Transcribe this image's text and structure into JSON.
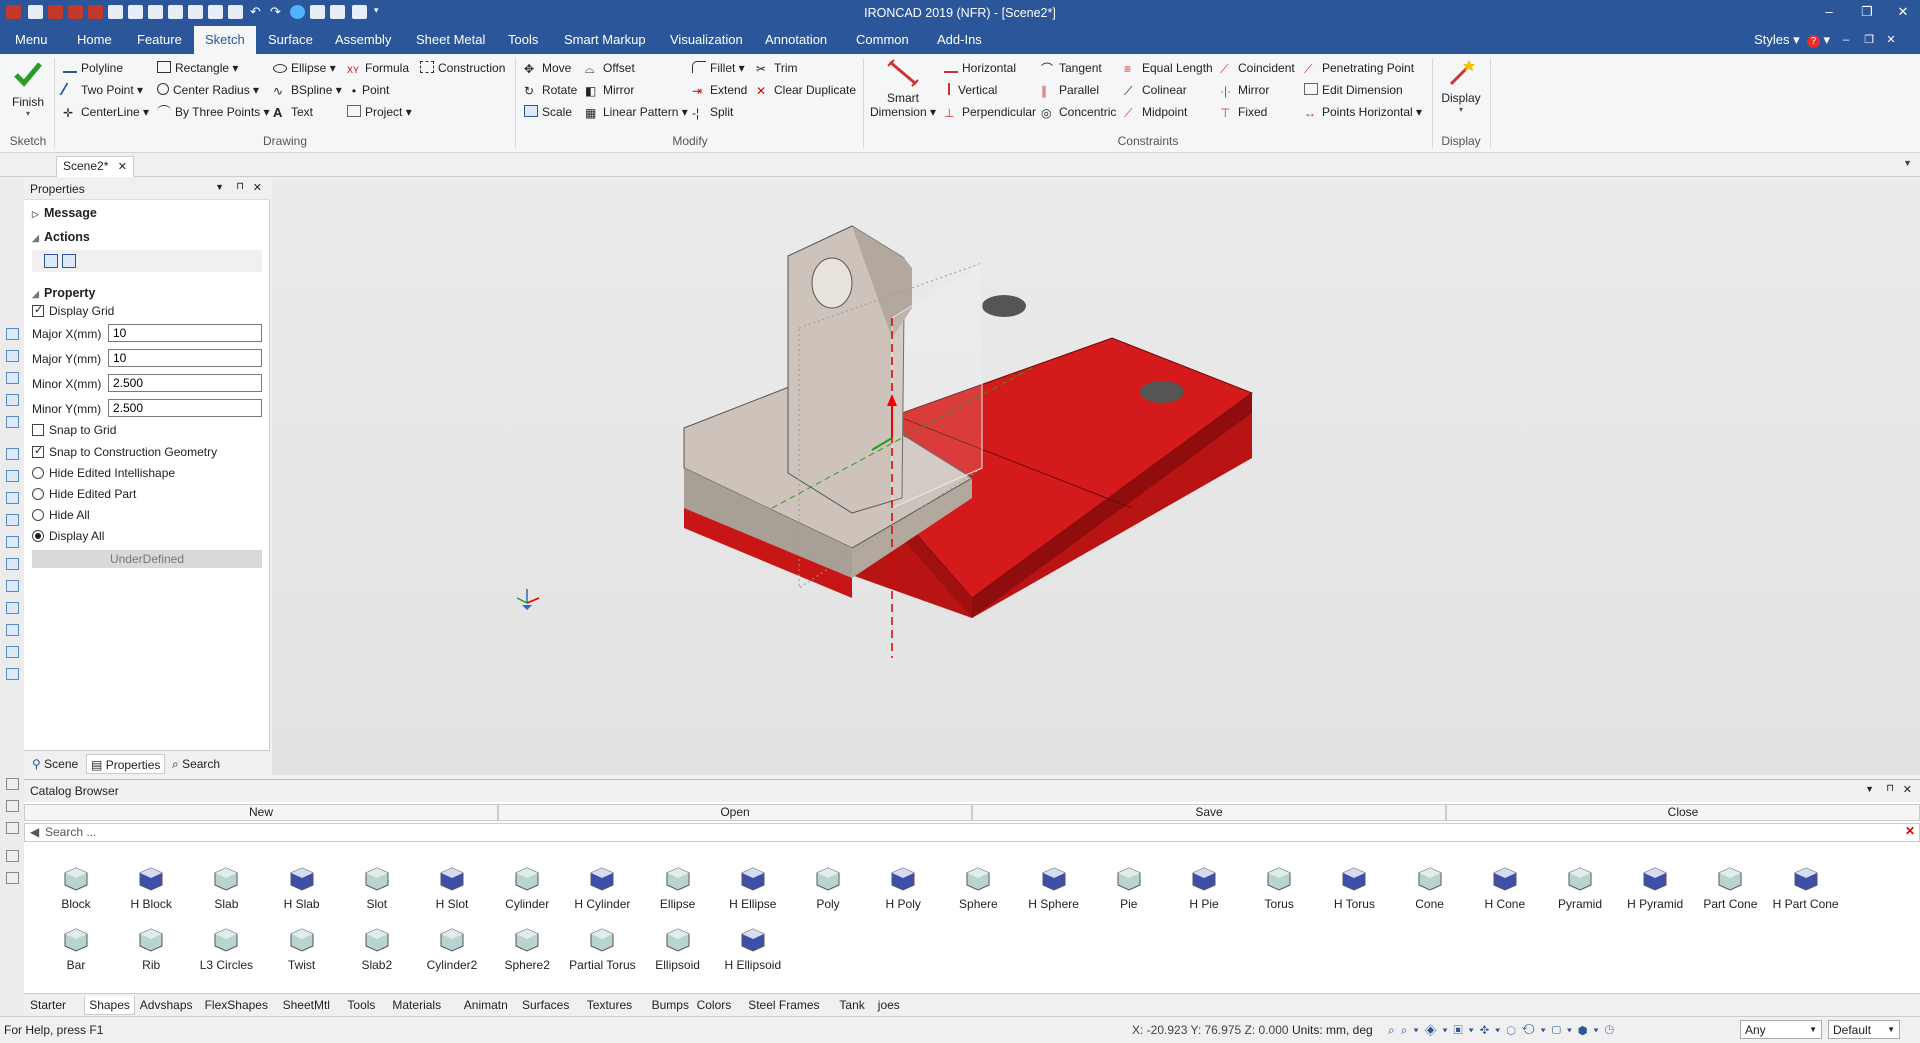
{
  "app": {
    "title": "IRONCAD 2019 (NFR) - [Scene2*]"
  },
  "menu": {
    "tabs": [
      "Menu",
      "Home",
      "Feature",
      "Sketch",
      "Surface",
      "Assembly",
      "Sheet Metal",
      "Tools",
      "Smart Markup",
      "Visualization",
      "Annotation",
      "Common",
      "Add-Ins"
    ],
    "active": "Sketch",
    "styles": "Styles"
  },
  "ribbon": {
    "sketch": {
      "finish": "Finish",
      "group": "Sketch"
    },
    "drawing": {
      "group": "Drawing",
      "items": [
        "Polyline",
        "Two Point",
        "CenterLine",
        "Rectangle",
        "Center Radius",
        "By Three Points",
        "Ellipse",
        "BSpline",
        "Text",
        "Formula",
        "Point",
        "Project",
        "Construction"
      ]
    },
    "modify": {
      "group": "Modify",
      "items": [
        "Move",
        "Rotate",
        "Scale",
        "Offset",
        "Mirror",
        "Linear Pattern",
        "Fillet",
        "Extend",
        "Split",
        "Trim",
        "Clear Duplicate"
      ]
    },
    "constraints": {
      "group": "Constraints",
      "smart1": "Smart",
      "smart2": "Dimension",
      "items": [
        "Horizontal",
        "Vertical",
        "Perpendicular",
        "Tangent",
        "Parallel",
        "Concentric",
        "Equal Length",
        "Colinear",
        "Midpoint",
        "Coincident",
        "Mirror",
        "Fixed",
        "Penetrating Point",
        "Edit Dimension",
        "Points Horizontal"
      ]
    },
    "display": {
      "label": "Display",
      "group": "Display"
    }
  },
  "doc": {
    "tab": "Scene2*"
  },
  "properties": {
    "title": "Properties",
    "sections": {
      "message": "Message",
      "actions": "Actions",
      "property": "Property"
    },
    "display_grid": "Display Grid",
    "fields": [
      {
        "label": "Major X(mm)",
        "value": "10"
      },
      {
        "label": "Major Y(mm)",
        "value": "10"
      },
      {
        "label": "Minor X(mm)",
        "value": "2.500"
      },
      {
        "label": "Minor Y(mm)",
        "value": "2.500"
      }
    ],
    "snap_grid": "Snap to Grid",
    "snap_construction": "Snap to Construction Geometry",
    "radios": [
      "Hide Edited Intellishape",
      "Hide Edited Part",
      "Hide All",
      "Display All"
    ],
    "status": "UnderDefined",
    "tabs": [
      "Scene",
      "Properties",
      "Search"
    ]
  },
  "catalog": {
    "title": "Catalog Browser",
    "bar": [
      "New",
      "Open",
      "Save",
      "Close"
    ],
    "search_placeholder": "Search ...",
    "row1": [
      "Block",
      "H Block",
      "Slab",
      "H Slab",
      "Slot",
      "H Slot",
      "Cylinder",
      "H Cylinder",
      "Ellipse",
      "H Ellipse",
      "Poly",
      "H Poly",
      "Sphere",
      "H Sphere",
      "Pie",
      "H Pie",
      "Torus",
      "H Torus",
      "Cone",
      "H Cone",
      "Pyramid",
      "H Pyramid",
      "Part Cone",
      "H Part Cone"
    ],
    "row2": [
      "Bar",
      "Rib",
      "L3 Circles",
      "Twist",
      "Slab2",
      "Cylinder2",
      "Sphere2",
      "Partial Torus",
      "Ellipsoid",
      "H Ellipsoid"
    ],
    "tabs": [
      "Starter",
      "Shapes",
      "Advshaps",
      "FlexShapes",
      "SheetMtl",
      "Tools",
      "Materials",
      "Animatn",
      "Surfaces",
      "Textures",
      "Bumps",
      "Colors",
      "Steel Frames",
      "Tank",
      "joes"
    ],
    "active_tab": "Shapes"
  },
  "status": {
    "help": "For Help, press F1",
    "coords": "X: -20.923 Y: 76.975 Z: 0.000",
    "units": "Units: mm, deg",
    "filter": "Any",
    "view": "Default"
  },
  "colors": {
    "accent": "#2b579a",
    "part_red": "#d41a1a",
    "part_gray": "#c8beb4"
  }
}
